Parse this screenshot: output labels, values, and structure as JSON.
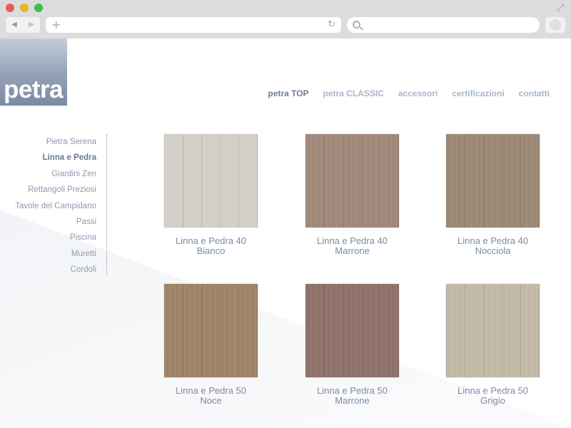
{
  "browser": {
    "address_value": "",
    "search_value": ""
  },
  "site": {
    "logo_text": "petra"
  },
  "topnav": [
    {
      "label": "petra TOP",
      "active": true
    },
    {
      "label": "petra CLASSIC",
      "active": false
    },
    {
      "label": "accessori",
      "active": false
    },
    {
      "label": "certificazioni",
      "active": false
    },
    {
      "label": "contatti",
      "active": false
    }
  ],
  "sidebar": [
    {
      "label": "Pietra Serena",
      "active": false
    },
    {
      "label": "Linna e Pedra",
      "active": true
    },
    {
      "label": "Giardini Zen",
      "active": false
    },
    {
      "label": "Rettangoli Preziosi",
      "active": false
    },
    {
      "label": "Tavole del Campidano",
      "active": false
    },
    {
      "label": "Passi",
      "active": false
    },
    {
      "label": "Piscina",
      "active": false
    },
    {
      "label": "Muretti",
      "active": false
    },
    {
      "label": "Cordoli",
      "active": false
    }
  ],
  "products": [
    {
      "line1": "Linna e Pedra 40",
      "line2": "Bianco",
      "color": "#d3cec7"
    },
    {
      "line1": "Linna e Pedra 40",
      "line2": "Marrone",
      "color": "#a08879"
    },
    {
      "line1": "Linna e Pedra 40",
      "line2": "Nocciola",
      "color": "#9b8773"
    },
    {
      "line1": "Linna e Pedra 50",
      "line2": "Noce",
      "color": "#9e8466"
    },
    {
      "line1": "Linna e Pedra 50",
      "line2": "Marrone",
      "color": "#8e726a"
    },
    {
      "line1": "Linna e Pedra 50",
      "line2": "Grigio",
      "color": "#c2b8a6"
    }
  ],
  "colors": {
    "nav_inactive": "#a9b6c8",
    "nav_active": "#6f7f94",
    "caption": "#7a8ba3"
  }
}
